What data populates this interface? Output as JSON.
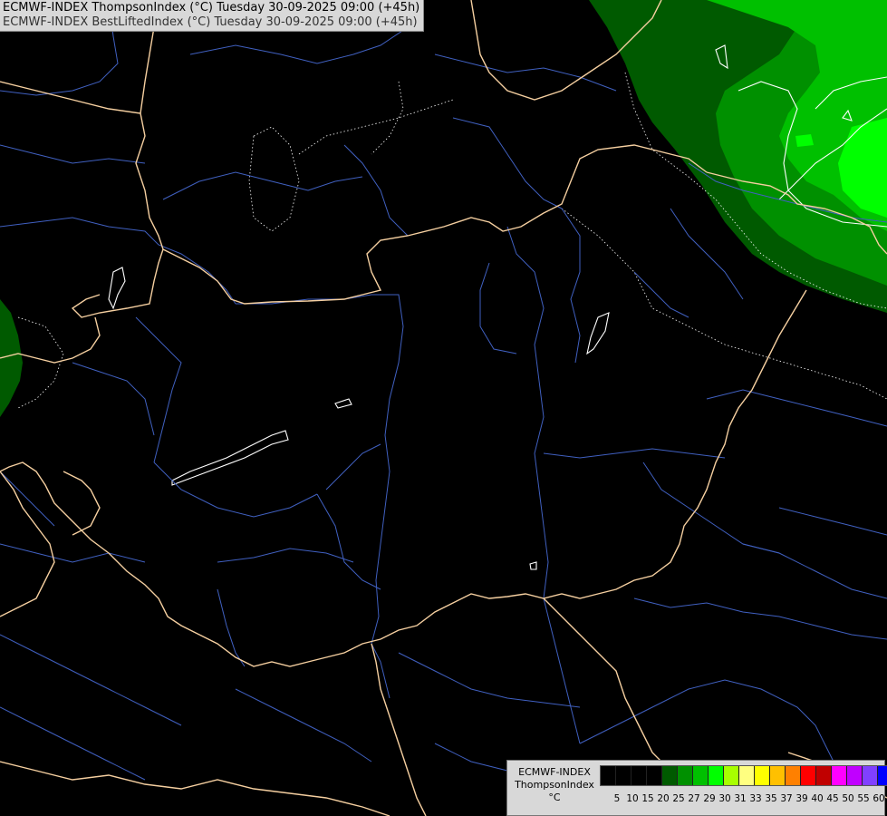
{
  "header": {
    "line1": "ECMWF-INDEX ThompsonIndex (°C) Tuesday 30-09-2025 09:00 (+45h)",
    "line2": "ECMWF-INDEX BestLiftedIndex (°C) Tuesday 30-09-2025 09:00 (+45h)"
  },
  "legend": {
    "model": "ECMWF-INDEX",
    "parameter": "ThompsonIndex",
    "unit": "°C",
    "ticks": [
      "5",
      "10",
      "15",
      "20",
      "25",
      "27",
      "29",
      "30",
      "31",
      "33",
      "35",
      "37",
      "39",
      "40",
      "45",
      "50",
      "55",
      "60"
    ],
    "colors": [
      "#000000",
      "#000000",
      "#000000",
      "#000000",
      "#005a00",
      "#009000",
      "#00c000",
      "#00ff00",
      "#a8ff00",
      "#ffff80",
      "#ffff00",
      "#ffc000",
      "#ff8000",
      "#ff0000",
      "#c00000",
      "#ff00ff",
      "#c000ff",
      "#8040ff",
      "#0000ff"
    ]
  },
  "colors": {
    "background": "#000000",
    "border": "#f5cfa0",
    "river": "#4060c0",
    "field_dark": "#005a00",
    "field_mid": "#009000",
    "field_light": "#00c000",
    "field_bright": "#00ff00"
  }
}
